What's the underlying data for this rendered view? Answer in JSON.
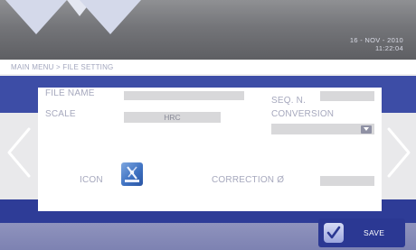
{
  "header": {
    "date": "16 - NOV - 2010",
    "time": "11:22:04"
  },
  "breadcrumb": "MAIN MENU > FILE SETTING",
  "form": {
    "file_name_label": "FILE NAME",
    "file_name_value": "",
    "seq_label": "SEQ. N.",
    "seq_value": "",
    "scale_label": "SCALE",
    "scale_value": "HRC",
    "conversion_label": "CONVERSION",
    "conversion_value": "",
    "icon_label": "ICON",
    "correction_label": "CORRECTION Ø",
    "correction_value": ""
  },
  "footer": {
    "save_label": "SAVE"
  },
  "icons": {
    "nav_left": "chevron-left-icon",
    "nav_right": "chevron-right-icon",
    "file_icon": "tester-icon",
    "save_check": "checkmark-icon",
    "dropdown": "chevron-down-icon"
  },
  "colors": {
    "header": "#747579",
    "accent_blue": "#3d4da6",
    "save_button": "#2b3893",
    "label_text": "#a6a8bd"
  }
}
